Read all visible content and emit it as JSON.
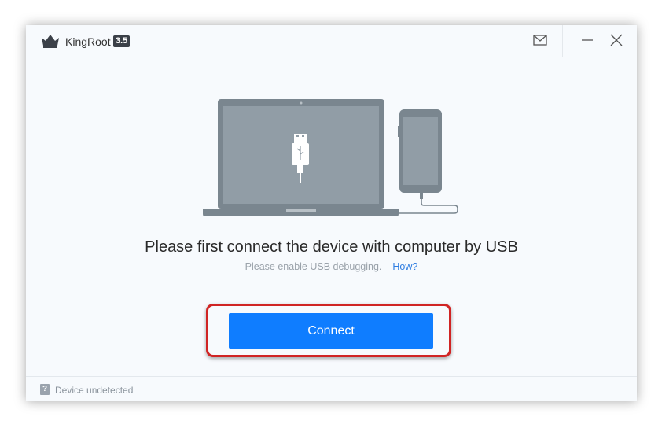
{
  "titlebar": {
    "app_name": "KingRoot",
    "version": "3.5"
  },
  "icons": {
    "logo": "crown-icon",
    "mail": "mail-icon",
    "minimize": "minimize-icon",
    "close": "close-icon",
    "status": "question-icon"
  },
  "main": {
    "headline": "Please first connect the device with computer by USB",
    "subline": "Please enable USB debugging.",
    "how_link": "How?",
    "connect_label": "Connect"
  },
  "status": {
    "icon_glyph": "?",
    "text": "Device undetected"
  },
  "colors": {
    "accent": "#0f7dff",
    "link": "#2f7de1",
    "highlight_border": "#d02424",
    "illustration": "#7a868f"
  }
}
